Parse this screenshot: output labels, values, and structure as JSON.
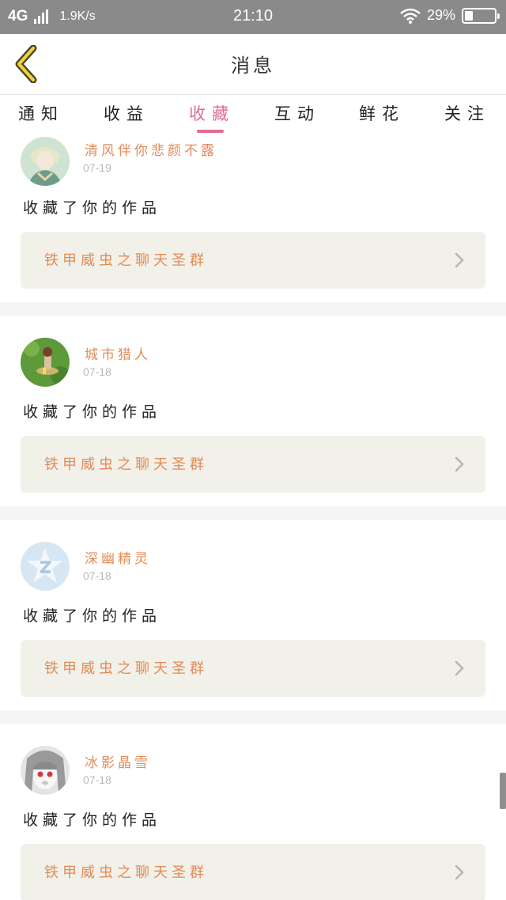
{
  "status_bar": {
    "network": "4G",
    "speed": "1.9K/s",
    "time": "21:10",
    "battery_text": "29%",
    "battery_level": 0.29
  },
  "navbar": {
    "back_icon": "chevron-left-icon",
    "title": "消息"
  },
  "tabs": [
    {
      "label": "通知",
      "active": false
    },
    {
      "label": "收益",
      "active": false
    },
    {
      "label": "收藏",
      "active": true
    },
    {
      "label": "互动",
      "active": false
    },
    {
      "label": "鲜花",
      "active": false
    },
    {
      "label": "关注",
      "active": false
    }
  ],
  "colors": {
    "accent": "#e06b98",
    "username": "#e38b57",
    "work_box": "#f1f1ea",
    "status_bar": "#8a8a8a"
  },
  "feed": [
    {
      "username": "清风伴你悲颜不露",
      "date": "07-19",
      "action": "收藏了你的作品",
      "work_title": "铁甲威虫之聊天圣群",
      "avatar": "anime-boy-avatar"
    },
    {
      "username": "城市猎人",
      "date": "07-18",
      "action": "收藏了你的作品",
      "work_title": "铁甲威虫之聊天圣群",
      "avatar": "game-character-avatar"
    },
    {
      "username": "深幽精灵",
      "date": "07-18",
      "action": "收藏了你的作品",
      "work_title": "铁甲威虫之聊天圣群",
      "avatar": "default-qq-avatar"
    },
    {
      "username": "冰影晶雪",
      "date": "07-18",
      "action": "收藏了你的作品",
      "work_title": "铁甲威虫之聊天圣群",
      "avatar": "anime-girl-avatar"
    }
  ]
}
